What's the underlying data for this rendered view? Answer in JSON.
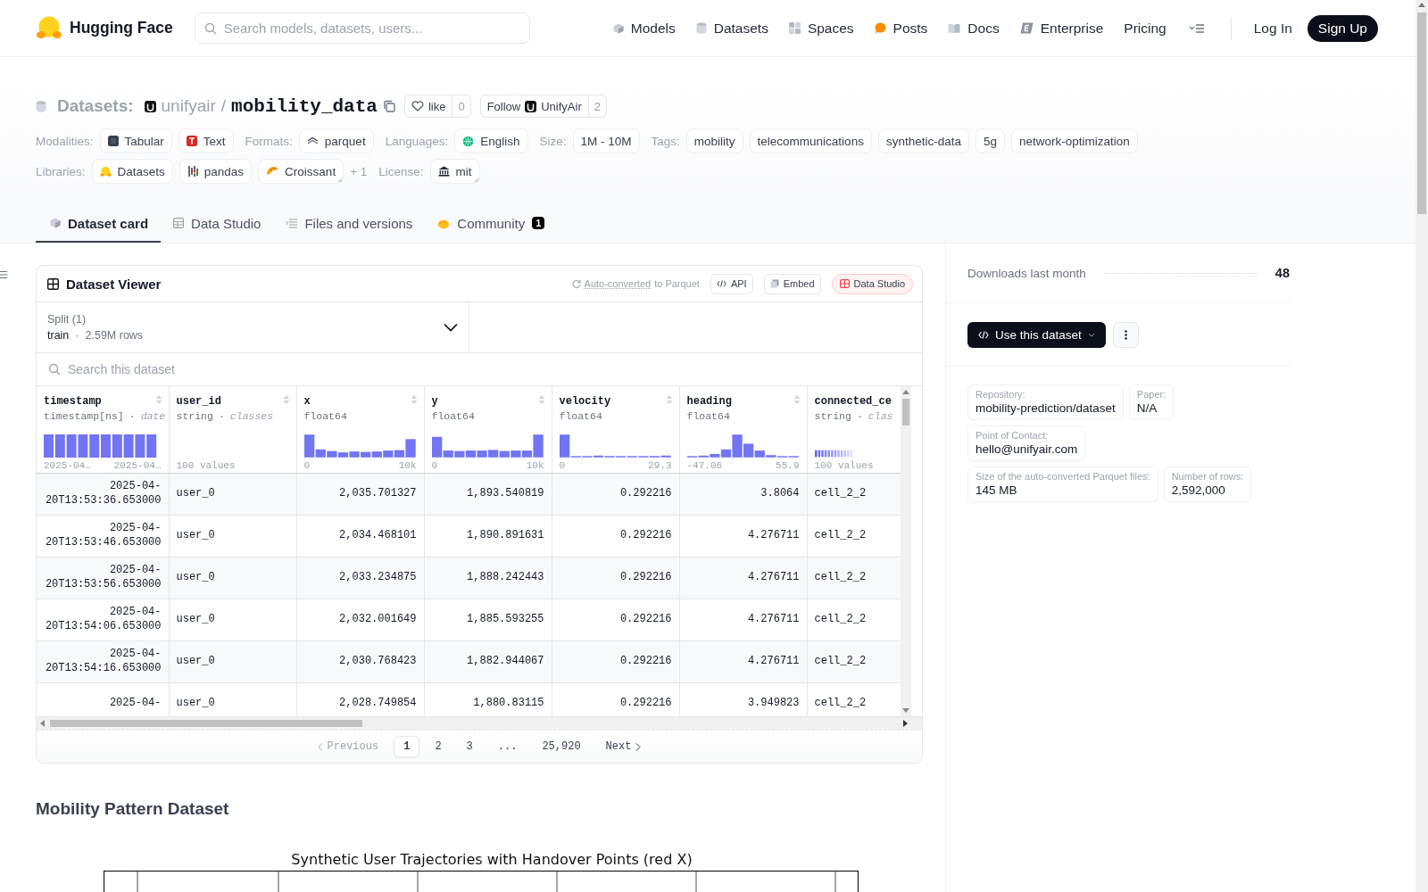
{
  "header": {
    "logo": "Hugging Face",
    "search": {
      "placeholder": "Search models, datasets, users..."
    },
    "nav": [
      {
        "label": "Models"
      },
      {
        "label": "Datasets"
      },
      {
        "label": "Spaces"
      },
      {
        "label": "Posts"
      },
      {
        "label": "Docs"
      },
      {
        "label": "Enterprise"
      },
      {
        "label": "Pricing"
      }
    ],
    "login": "Log In",
    "signup": "Sign Up"
  },
  "repo": {
    "section": "Datasets:",
    "owner": "unifyair",
    "separator": "/",
    "name": "mobility_data",
    "like": {
      "label": "like",
      "count": "0"
    },
    "follow": {
      "label": "Follow",
      "org": "UnifyAir",
      "count": "2"
    },
    "meta_rows": [
      [
        {
          "label": "Modalities:",
          "tags": [
            {
              "text": "Tabular",
              "menu": false
            },
            {
              "text": "Text",
              "menu": false
            }
          ]
        },
        {
          "label": "Formats:",
          "tags": [
            {
              "text": "parquet",
              "menu": false
            }
          ]
        },
        {
          "label": "Languages:",
          "tags": [
            {
              "text": "English",
              "menu": false
            }
          ]
        },
        {
          "label": "Size:",
          "tags": [
            {
              "text": "1M - 10M",
              "menu": false
            }
          ]
        },
        {
          "label": "Tags:",
          "tags": [
            {
              "text": "mobility",
              "menu": false
            },
            {
              "text": "telecommunications",
              "menu": false
            },
            {
              "text": "synthetic-data",
              "menu": false
            },
            {
              "text": "5g",
              "menu": false
            },
            {
              "text": "network-optimization",
              "menu": false
            }
          ]
        }
      ],
      [
        {
          "label": "Libraries:",
          "tags": [
            {
              "text": "Datasets",
              "menu": false
            },
            {
              "text": "pandas",
              "menu": false
            },
            {
              "text": "Croissant",
              "menu": true
            }
          ],
          "more": "+ 1"
        },
        {
          "label": "License:",
          "tags": [
            {
              "text": "mit",
              "menu": true
            }
          ]
        }
      ]
    ],
    "tabs": [
      {
        "label": "Dataset card",
        "selected": true
      },
      {
        "label": "Data Studio",
        "selected": false
      },
      {
        "label": "Files and versions",
        "selected": false
      },
      {
        "label": "Community",
        "selected": false,
        "badge": "1"
      }
    ]
  },
  "viewer": {
    "title": "Dataset Viewer",
    "auto_link": "Auto-converted",
    "auto_rest": "to Parquet",
    "buttons": [
      "API",
      "Embed",
      "Data Studio"
    ],
    "split": {
      "label": "Split (1)",
      "name": "train",
      "separator": "·",
      "rows": "2.59M rows"
    },
    "search": {
      "placeholder": "Search this dataset"
    },
    "columns": [
      {
        "name": "timestamp",
        "type": "timestamp[ns]",
        "separator": "·",
        "hint": "date",
        "kind": "uniform",
        "min": "2025-04…",
        "max": "2025-04…"
      },
      {
        "name": "user_id",
        "type": "string",
        "separator": "·",
        "hint": "classes",
        "kind": "none",
        "min": "100 values"
      },
      {
        "name": "x",
        "type": "float64",
        "kind": "histogram",
        "min": "0",
        "max": "10k"
      },
      {
        "name": "y",
        "type": "float64",
        "kind": "histogram",
        "min": "0",
        "max": "10k"
      },
      {
        "name": "velocity",
        "type": "float64",
        "kind": "histogram",
        "min": "0",
        "max": "29.3"
      },
      {
        "name": "heading",
        "type": "float64",
        "kind": "histogram",
        "min": "-47.06",
        "max": "55.9"
      },
      {
        "name": "connected_ce",
        "type": "string",
        "separator": "·",
        "hint": "clas",
        "kind": "classes",
        "min": "100 values"
      }
    ],
    "rows": [
      [
        "2025-04-20T13:53:36.653000",
        "user_0",
        "2,035.701327",
        "1,893.540819",
        "0.292216",
        "3.8064",
        "cell_2_2"
      ],
      [
        "2025-04-20T13:53:46.653000",
        "user_0",
        "2,034.468101",
        "1,890.891631",
        "0.292216",
        "4.276711",
        "cell_2_2"
      ],
      [
        "2025-04-20T13:53:56.653000",
        "user_0",
        "2,033.234875",
        "1,888.242443",
        "0.292216",
        "4.276711",
        "cell_2_2"
      ],
      [
        "2025-04-20T13:54:06.653000",
        "user_0",
        "2,032.001649",
        "1,885.593255",
        "0.292216",
        "4.276711",
        "cell_2_2"
      ],
      [
        "2025-04-20T13:54:16.653000",
        "user_0",
        "2,030.768423",
        "1,882.944067",
        "0.292216",
        "4.276711",
        "cell_2_2"
      ],
      [
        "2025-04-",
        "user_0",
        "2,028.749854",
        "1,880.83115",
        "0.292216",
        "3.949823",
        "cell_2_2"
      ]
    ],
    "pagination": {
      "previous": {
        "label": "Previous",
        "disabled": true
      },
      "pages": [
        {
          "label": "1",
          "selected": true
        },
        {
          "label": "2",
          "selected": false
        },
        {
          "label": "3",
          "selected": false
        },
        {
          "label": "...",
          "selected": false
        },
        {
          "label": "25,920",
          "selected": false
        }
      ],
      "next": {
        "label": "Next",
        "disabled": false
      }
    }
  },
  "card": {
    "heading": "Mobility Pattern Dataset",
    "figure_title": "Synthetic User Trajectories with Handover Points (red X)"
  },
  "sidebar": {
    "downloads": {
      "label": "Downloads last month",
      "value": "48"
    },
    "use_button": "Use this dataset",
    "info": [
      [
        {
          "label": "Repository:",
          "value": "mobility-prediction/dataset"
        },
        {
          "label": "Paper:",
          "value": "N/A"
        }
      ],
      [
        {
          "label": "Point of Contact:",
          "value": "hello@unifyair.com"
        }
      ],
      [
        {
          "label": "Size of the auto-converted Parquet files:",
          "value": "145 MB"
        },
        {
          "label": "Number of rows:",
          "value": "2,592,000"
        }
      ]
    ]
  }
}
